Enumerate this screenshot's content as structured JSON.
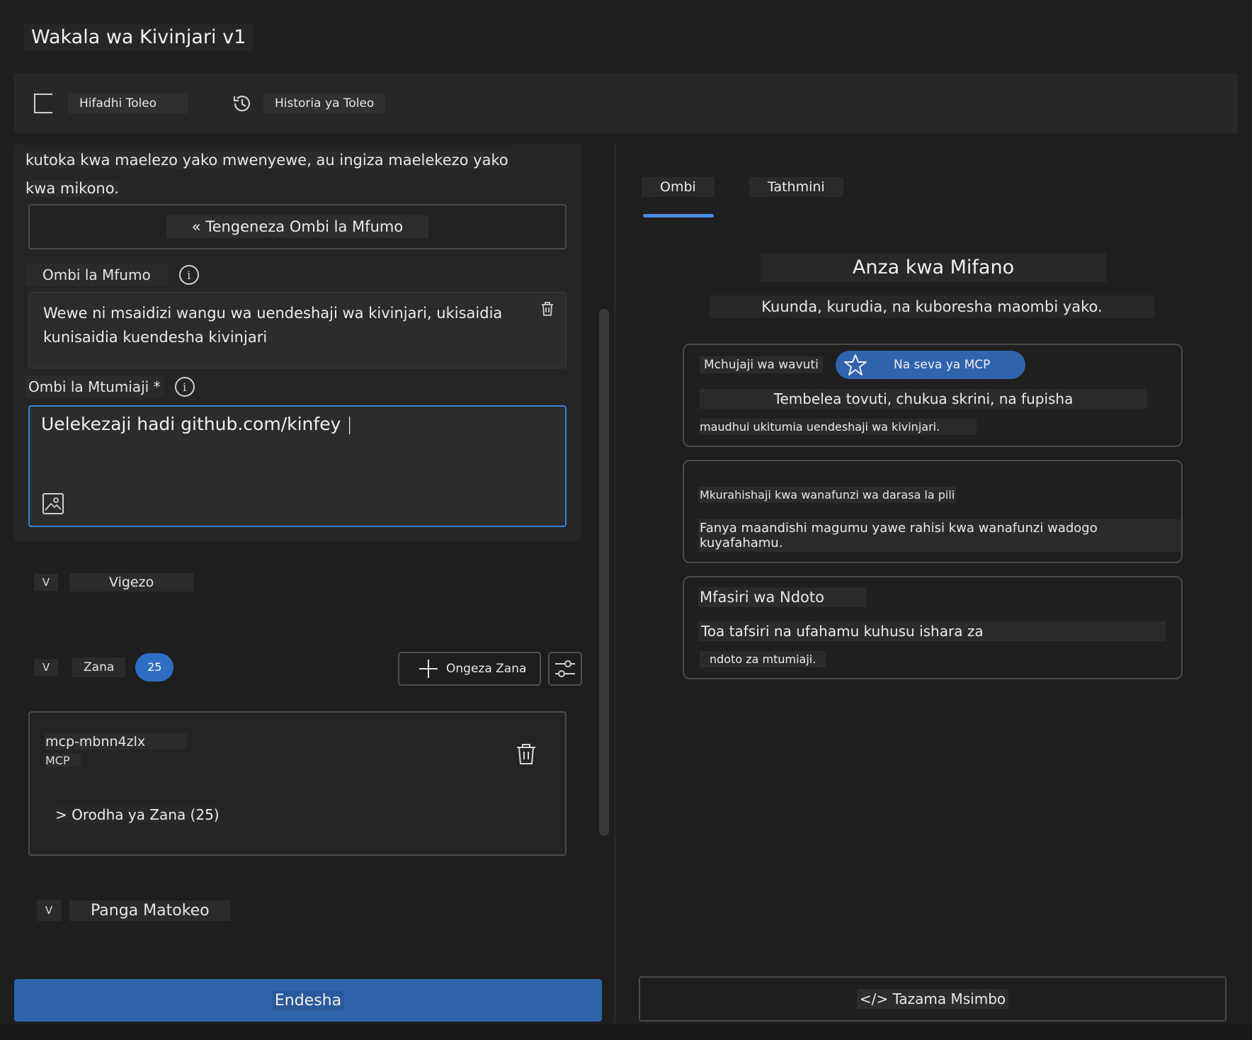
{
  "app": {
    "title": "Wakala wa Kivinjari v1"
  },
  "toolbar": {
    "save_label": "Hifadhi Toleo",
    "history_label": "Historia ya Toleo"
  },
  "left": {
    "intro_line1": "kutoka kwa maelezo yako mwenyewe, au ingiza maelekezo yako",
    "intro_line2": "kwa mikono.",
    "generate_button": "« Tengeneza Ombi la Mfumo",
    "system_prompt_label": "Ombi la Mfumo",
    "system_prompt_line1": "Wewe ni msaidizi wangu wa uendeshaji wa kivinjari, ukisaidia",
    "system_prompt_line2": "kunisaidia kuendesha kivinjari",
    "user_prompt_label": "Ombi la Mtumiaji *",
    "user_prompt_value": "Uelekezaji hadi github.com/kinfey",
    "variables_chevron": "V",
    "variables_label": "Vigezo",
    "tools_chevron": "V",
    "tools_label": "Zana",
    "tools_count": "25",
    "add_tool_label": "Ongeza Zana",
    "mcp_name": "mcp-mbnn4zlx",
    "mcp_type": "MCP",
    "tool_list_label": "> Orodha ya Zana (25)",
    "format_chevron": "V",
    "format_label": "Panga Matokeo",
    "run_button": "Endesha"
  },
  "right": {
    "tabs": [
      {
        "label": "Ombi",
        "active": true
      },
      {
        "label": "Tathmini",
        "active": false
      }
    ],
    "examples_title": "Anza kwa Mifano",
    "examples_subtitle": "Kuunda, kurudia, na kuboresha maombi yako.",
    "cards": [
      {
        "title": "Mchujaji wa wavuti",
        "pill": "Na seva ya MCP",
        "desc_line1": "Tembelea tovuti, chukua skrini, na fupisha",
        "desc_line2": "maudhui ukitumia uendeshaji wa kivinjari."
      },
      {
        "title": "Mkurahishaji kwa wanafunzi wa darasa la pili",
        "desc_line1": "Fanya maandishi magumu yawe rahisi kwa wanafunzi wadogo kuyafahamu."
      },
      {
        "title": "Mfasiri wa Ndoto",
        "desc_line1": "Toa tafsiri na ufahamu kuhusu ishara za",
        "desc_line2": "ndoto za mtumiaji."
      }
    ],
    "view_code_button": "</> Tazama Msimbo"
  },
  "colors": {
    "accent": "#2f64ad",
    "focus_border": "#3f7fd8",
    "background": "#1e1e1e"
  }
}
